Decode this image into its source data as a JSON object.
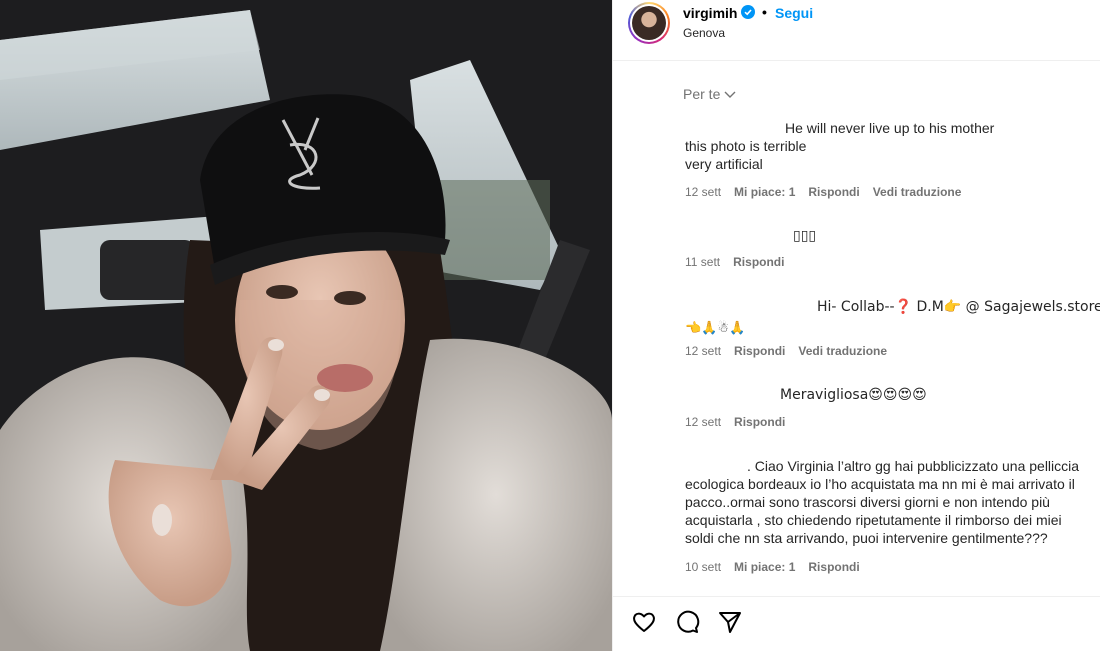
{
  "post": {
    "username": "virgimih",
    "follow_label": "Segui",
    "separator": "•",
    "location": "Genova",
    "sort_label": "Per te",
    "icons": {
      "verified": "verified-badge-icon",
      "like": "heart-icon",
      "comment": "comment-icon",
      "share": "share-icon",
      "sort": "chevron-down-icon"
    },
    "colors": {
      "accent": "#0095f6",
      "meta": "#737373"
    }
  },
  "comments": [
    {
      "lines": [
        "He will never live up to his mother",
        "this photo is terrible",
        "very artificial"
      ],
      "time": "12 sett",
      "likes": "Mi piace: 1",
      "reply": "Rispondi",
      "translate": "Vedi traduzione"
    },
    {
      "lines": [
        "▯▯▯"
      ],
      "time": "11 sett",
      "reply": "Rispondi"
    },
    {
      "lines": [
        "Hi- Collab--❓ D.M👉 @ Sagajewels.store",
        "👈🙏☃🙏"
      ],
      "time": "12 sett",
      "reply": "Rispondi",
      "translate": "Vedi traduzione"
    },
    {
      "lines": [
        "Meravigliosa😍😍😍😍"
      ],
      "time": "12 sett",
      "reply": "Rispondi"
    },
    {
      "lines": [
        ". Ciao Virginia l’altro gg hai pubblicizzato una pelliccia",
        "ecologica bordeaux io l’ho acquistata ma nn mi è mai arrivato il",
        "pacco..ormai sono trascorsi diversi giorni e non intendo più",
        "acquistarla , sto chiedendo ripetutamente il rimborso dei miei",
        "soldi che nn sta arrivando, puoi intervenire gentilmente???"
      ],
      "time": "10 sett",
      "likes": "Mi piace: 1",
      "reply": "Rispondi"
    }
  ]
}
